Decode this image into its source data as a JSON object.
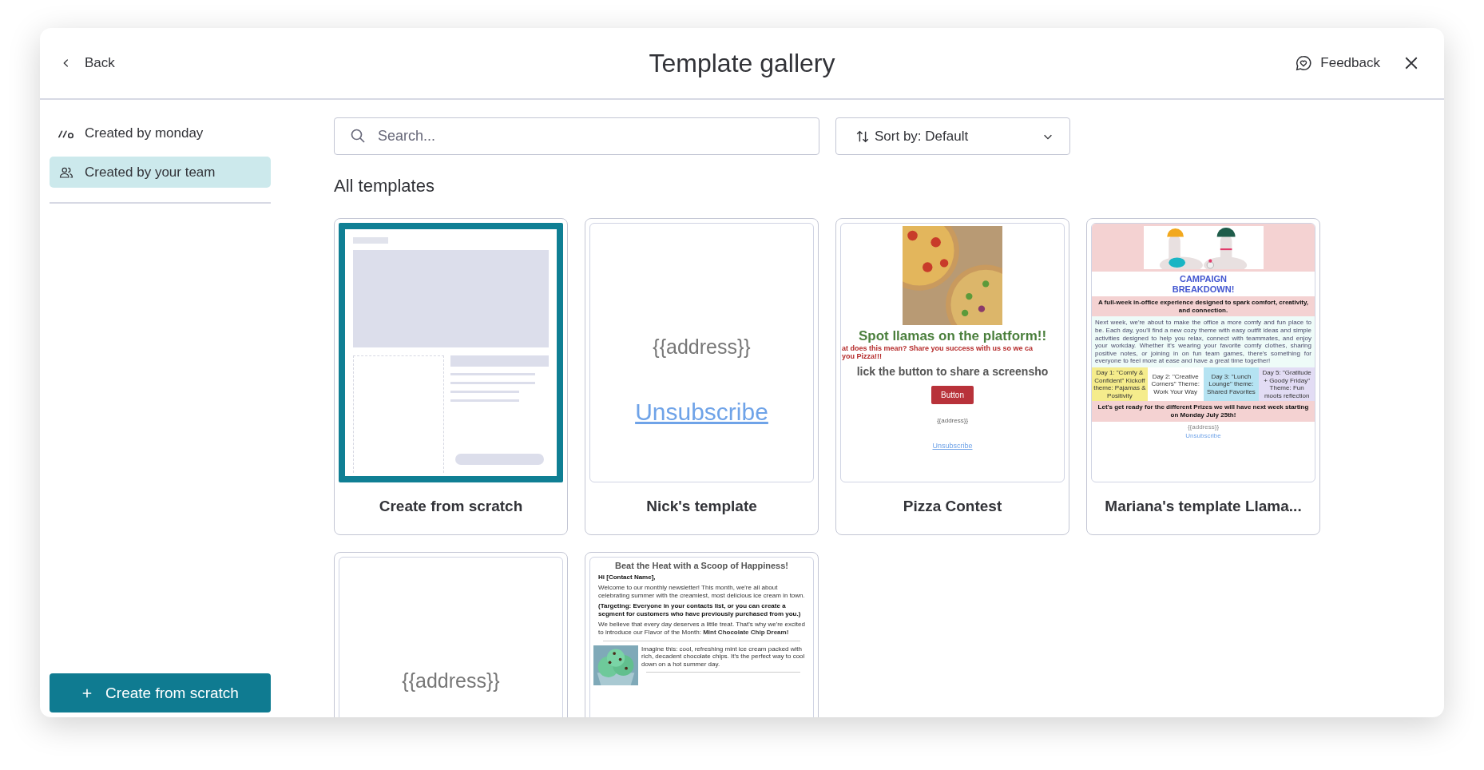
{
  "header": {
    "back": "Back",
    "title": "Template gallery",
    "feedback": "Feedback"
  },
  "sidebar": {
    "items": [
      {
        "label": "Created by monday",
        "kind": "brand",
        "selected": false
      },
      {
        "label": "Created by your team",
        "kind": "team",
        "selected": true
      }
    ],
    "create_button": "Create from scratch"
  },
  "search": {
    "placeholder": "Search..."
  },
  "sort": {
    "label": "Sort by: Default"
  },
  "section_title": "All templates",
  "templates": [
    {
      "name": "Create from scratch",
      "kind": "blank"
    },
    {
      "name": "Nick's template",
      "kind": "address",
      "preview": {
        "address": "{{address}}",
        "link": "Unsubscribe"
      }
    },
    {
      "name": "Pizza Contest",
      "kind": "pizza",
      "preview": {
        "headline": "Spot llamas on the platform!!",
        "lines": [
          "at does this mean? Share you success with us so we ca",
          "you Pizza!!!"
        ],
        "call": "lick the button to share a screensho",
        "button": "Button",
        "address": "{{address}}",
        "link": "Unsubscribe"
      }
    },
    {
      "name": "Mariana's template Llama...",
      "kind": "campaign",
      "preview": {
        "heading": "CAMPAIGN BREAKDOWN!",
        "subheading": "A full-week in-office experience designed to spark comfort, creativity, and connection.",
        "paragraph": "Next week, we're about to make the office a more comfy and fun place to be. Each day, you'll find a new cozy theme with easy outfit ideas and simple activities designed to help you relax, connect with teammates, and enjoy your workday. Whether it's wearing your favorite comfy clothes, sharing positive notes, or joining in on fun team games, there's something for everyone to feel more at ease and have a great time together!",
        "days": [
          {
            "text": "Day 1: \"Comfy & Confident\" Kickoff theme: Pajamas & Positivity",
            "color": "#f5ec8c"
          },
          {
            "text": "Day 2: \"Creative Corners\" Theme: Work Your Way",
            "color": "#ffffff"
          },
          {
            "text": "Day 3: \"Lunch Lounge\" theme: Shared Favorites",
            "color": "#b5e3f2"
          },
          {
            "text": "Day 5: \"Gratitude + Goody Friday\" Theme: Fun moots reflection",
            "color": "#e2dcf4"
          }
        ],
        "closing": "Let's get ready for the different Prizes we will have next week starting on Monday July 25th!",
        "address": "{{address}}",
        "link": "Unsubscribe"
      }
    },
    {
      "kind": "address",
      "preview": {
        "address": "{{address}}"
      }
    },
    {
      "kind": "newsletter",
      "preview": {
        "title": "Beat the Heat with a Scoop of Happiness!",
        "greeting": "Hi [Contact Name],",
        "intro": "Welcome to our monthly newsletter! This month, we're all about celebrating summer with the creamiest, most delicious ice cream in town.",
        "targeting": "(Targeting: Everyone in your contacts list, or you can create a segment for customers who have previously purchased from you.)",
        "body": "We believe that every day deserves a little treat. That's why we're excited to introduce our Flavor of the Month: **Mint Chocolate Chip Dream!**",
        "feature": "Imagine this: cool, refreshing mint ice cream packed with rich, decadent chocolate chips. It's the perfect way to cool down on a hot summer day."
      }
    }
  ]
}
